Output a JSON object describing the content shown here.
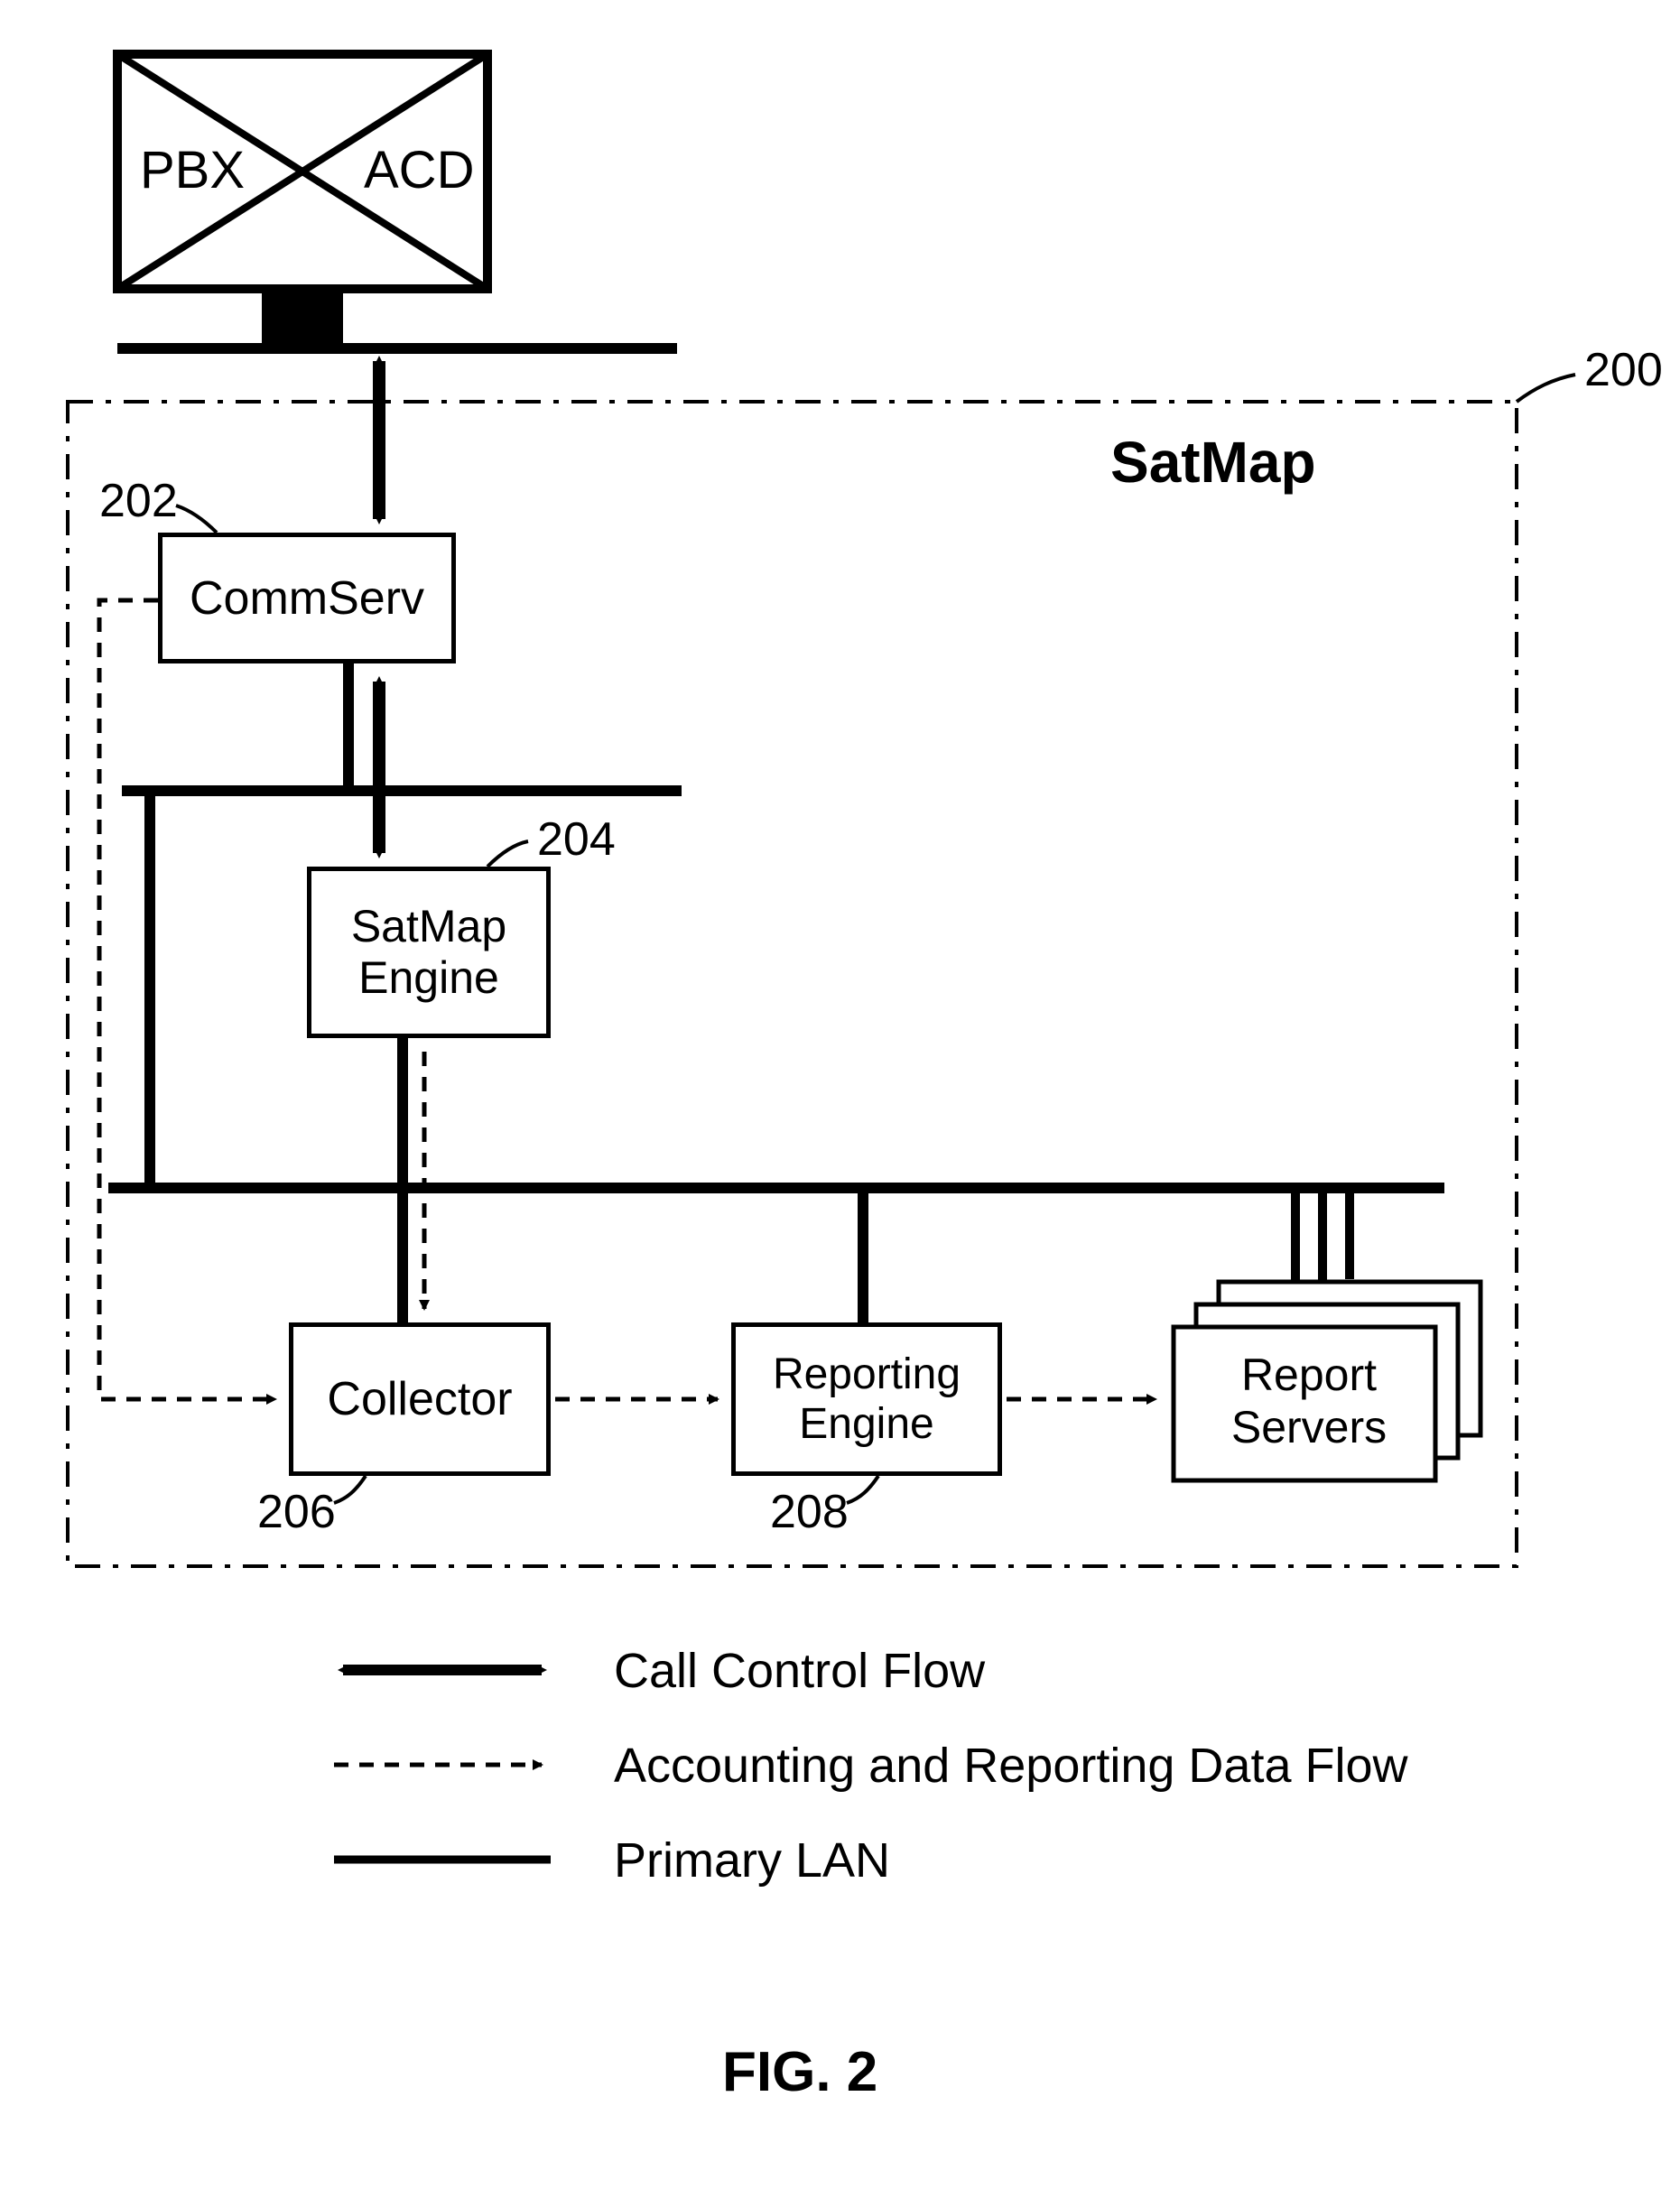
{
  "pbx": {
    "label_left": "PBX",
    "label_right": "ACD"
  },
  "satmap": {
    "title": "SatMap",
    "ref_num": "200"
  },
  "commserv": {
    "label": "CommServ",
    "ref_num": "202"
  },
  "engine": {
    "label_line1": "SatMap",
    "label_line2": "Engine",
    "ref_num": "204"
  },
  "collector": {
    "label": "Collector",
    "ref_num": "206"
  },
  "reporting": {
    "label_line1": "Reporting",
    "label_line2": "Engine",
    "ref_num": "208"
  },
  "reportservers": {
    "label_line1": "Report",
    "label_line2": "Servers"
  },
  "legend": {
    "item1": "Call Control Flow",
    "item2": "Accounting and Reporting Data Flow",
    "item3": "Primary LAN"
  },
  "fig": "FIG. 2"
}
